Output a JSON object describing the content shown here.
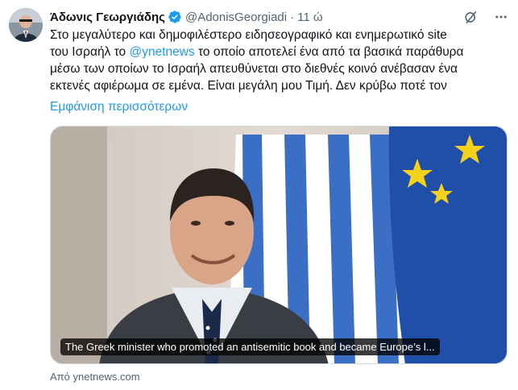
{
  "tweet": {
    "author_name": "Άδωνις Γεωργιάδης",
    "handle": "@AdonisGeorgiadi",
    "separator": "·",
    "time": "11 ώ",
    "text_lines": [
      "Στο μεγαλύτερο και δημοφιλέστερο ειδησεογραφικό και ενημερωτικό site",
      "το οποίο αποτελεί ένα από τα βασικά παράθυρα",
      "μέσω των οποίων το Ισραήλ απευθύνεται στο διεθνές κοινό ανέβασαν ένα",
      "εκτενές αφιέρωμα σε εμένα. Είναι μεγάλη μου Τιμή. Δεν κρύβω ποτέ τον"
    ],
    "line2_prefix": "του Ισραήλ το ",
    "mention": "@ynetnews",
    "show_more": "Εμφάνιση περισσότερων",
    "icons": [
      "verified-badge-icon",
      "grok-icon",
      "more-icon"
    ],
    "colors": {
      "accent": "#1d9bf0",
      "secondary_text": "#536471"
    }
  },
  "card": {
    "title": "The Greek minister who promoted an antisemitic book and became Europe’s l...",
    "source": "Από ynetnews.com"
  }
}
